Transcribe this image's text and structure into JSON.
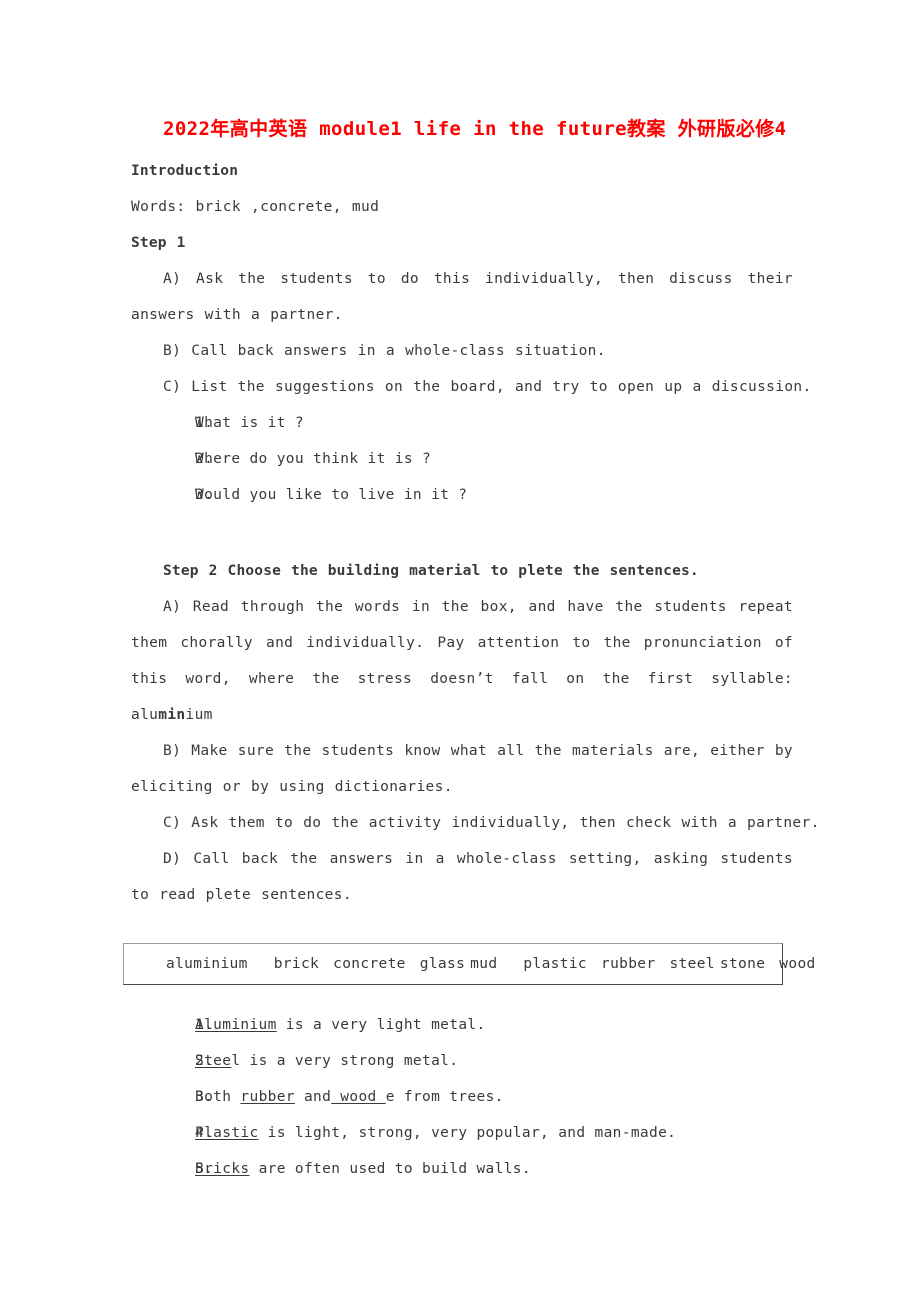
{
  "document": {
    "title": "2022年高中英语 module1 life in the future教案 外研版必修4",
    "title_color": "#ff0000",
    "section_introduction": "Introduction",
    "words_line": "Words:  brick ,concrete, mud",
    "step1_heading": "Step 1",
    "step1_items": [
      "A)  Ask the students to do this individually, then discuss their answers with a partner.",
      "B)  Call back answers in a whole-class situation.",
      "C)  List the suggestions on the board, and try to open up a discussion."
    ],
    "step1_questions": [
      {
        "num": "1.",
        "text": "What is it ?"
      },
      {
        "num": "2.",
        "text": "Where do you think it is ?"
      },
      {
        "num": "3.",
        "text": "Would you like to live in it ?"
      }
    ],
    "step2_heading": "Step 2 Choose the building material to plete the sentences.",
    "step2_item_a_pre": "A)  Read through the words in the box, and have the students repeat them chorally and individually. Pay attention to the pronunciation of this word, where the stress doesn’t fall on the first syllable: alu",
    "step2_item_a_bold": "min",
    "step2_item_a_post": "ium",
    "step2_items": [
      "B)  Make sure the students know what all the materials are, either by eliciting or by using dictionaries.",
      "C)  Ask them to do the activity individually, then check with a partner.",
      "D)  Call back the answers in a whole-class setting, asking students to read plete sentences."
    ],
    "word_bank": [
      "aluminium",
      "brick",
      "concrete",
      "glass",
      "mud",
      "plastic",
      "rubber",
      "steel",
      "stone",
      "wood"
    ],
    "answers": [
      {
        "num": "1.",
        "blank": "Aluminium",
        "pre": "",
        "post": " is a very light metal."
      },
      {
        "num": "2.",
        "blank": "Stee",
        "pre": "",
        "post": "l is a very strong metal."
      },
      {
        "num": "3.",
        "blank": " wood ",
        "pre": "Both ",
        "blank2": "rubber",
        "mid": " and",
        "post": "e from trees."
      },
      {
        "num": "4.",
        "blank": "Plastic",
        "pre": "",
        "post": " is light, strong, very popular, and man-made."
      },
      {
        "num": "5.",
        "blank": "Bricks",
        "pre": "",
        "post": " are often used to build walls."
      }
    ]
  }
}
